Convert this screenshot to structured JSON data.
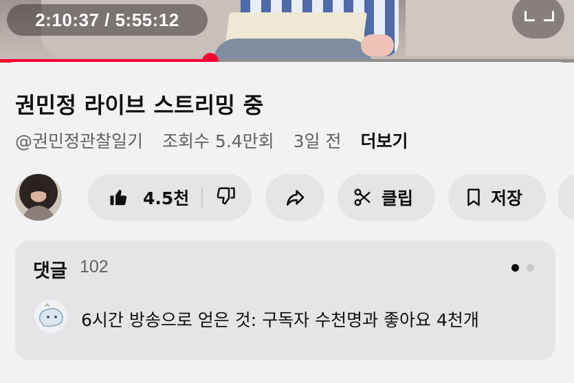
{
  "player": {
    "current_time": "2:10:37",
    "duration": "5:55:12",
    "time_display": "2:10:37 / 5:55:12",
    "progress_fraction": 0.367,
    "accent_color": "#ff0033"
  },
  "video": {
    "title": "권민정 라이브 스트리밍 중",
    "channel": "@권민정관찰일기",
    "views": "조회수 5.4만회",
    "age": "3일 전",
    "more_label": "더보기"
  },
  "actions": {
    "like_count": "4.5천",
    "clip_label": "클립",
    "save_label": "저장",
    "icons": [
      "like-icon",
      "dislike-icon",
      "share-icon",
      "scissors-icon",
      "bookmark-icon"
    ]
  },
  "comments": {
    "title": "댓글",
    "count": "102",
    "top_comment": "6시간 방송으로 얻은 것: 구독자 수천명과 좋아요 4천개",
    "page_index": 0,
    "page_total": 2
  }
}
